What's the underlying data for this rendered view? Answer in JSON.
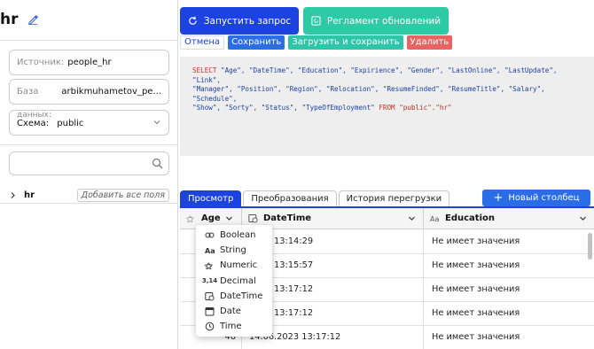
{
  "left": {
    "title": "hr",
    "source_label": "Источник:",
    "source_value": "people_hr",
    "db_label": "База",
    "db_value": "arbikmuhametov_pe...",
    "schema_group_label": "данных:",
    "schema_label": "Схема:",
    "schema_value": "public",
    "search_value": "",
    "tree_item": "hr",
    "add_all_label": "Добавить все поля"
  },
  "toolbar": {
    "run_label": "Запустить запрос",
    "schedule_label": "Регламент обновлений",
    "cancel_label": "Отмена",
    "save_label": "Сохранить",
    "load_save_label": "Загрузить и сохранить",
    "delete_label": "Удалить"
  },
  "sql": {
    "select": "SELECT",
    "cols_line1": "\"Age\", \"DateTime\", \"Education\", \"Expirience\", \"Gender\", \"LastOnline\", \"LastUpdate\", \"Link\",",
    "cols_line2": "\"Manager\", \"Position\", \"Region\", \"Relocation\", \"ResumeFinded\", \"ResumeTitle\", \"Salary\", \"Schedule\",",
    "cols_line3": "\"Show\", \"Sorty\", \"Status\", \"TypeOfEmployment\"",
    "from": "FROM",
    "table": "\"public\".\"hr\""
  },
  "tabs": [
    {
      "label": "Просмотр"
    },
    {
      "label": "Преобразования"
    },
    {
      "label": "История перегрузки"
    }
  ],
  "new_column_label": "Новый столбец",
  "table": {
    "columns": [
      "Age",
      "DateTime",
      "Education"
    ],
    "rows": [
      {
        "age": "",
        "datetime": "2023 13:14:29",
        "education": "Не имеет значения"
      },
      {
        "age": "",
        "datetime": "2023 13:15:57",
        "education": "Не имеет значения"
      },
      {
        "age": "",
        "datetime": "2023 13:17:12",
        "education": "Не имеет значения"
      },
      {
        "age": "",
        "datetime": "2023 13:17:12",
        "education": "Не имеет значения"
      },
      {
        "age": "46",
        "datetime": "14.06.2023 13:17:12",
        "education": "Не имеет значения"
      }
    ]
  },
  "type_menu": [
    {
      "icon": "boolean-icon",
      "label": "Boolean"
    },
    {
      "icon": "string-icon",
      "label": "String"
    },
    {
      "icon": "numeric-icon",
      "label": "Numeric"
    },
    {
      "icon": "decimal-icon",
      "label": "Decimal",
      "glyph": "3,14"
    },
    {
      "icon": "datetime-icon",
      "label": "DateTime"
    },
    {
      "icon": "date-icon",
      "label": "Date"
    },
    {
      "icon": "time-icon",
      "label": "Time"
    }
  ],
  "colors": {
    "primary": "#1c43e0",
    "accent": "#2ecaa6",
    "danger": "#e86464"
  }
}
